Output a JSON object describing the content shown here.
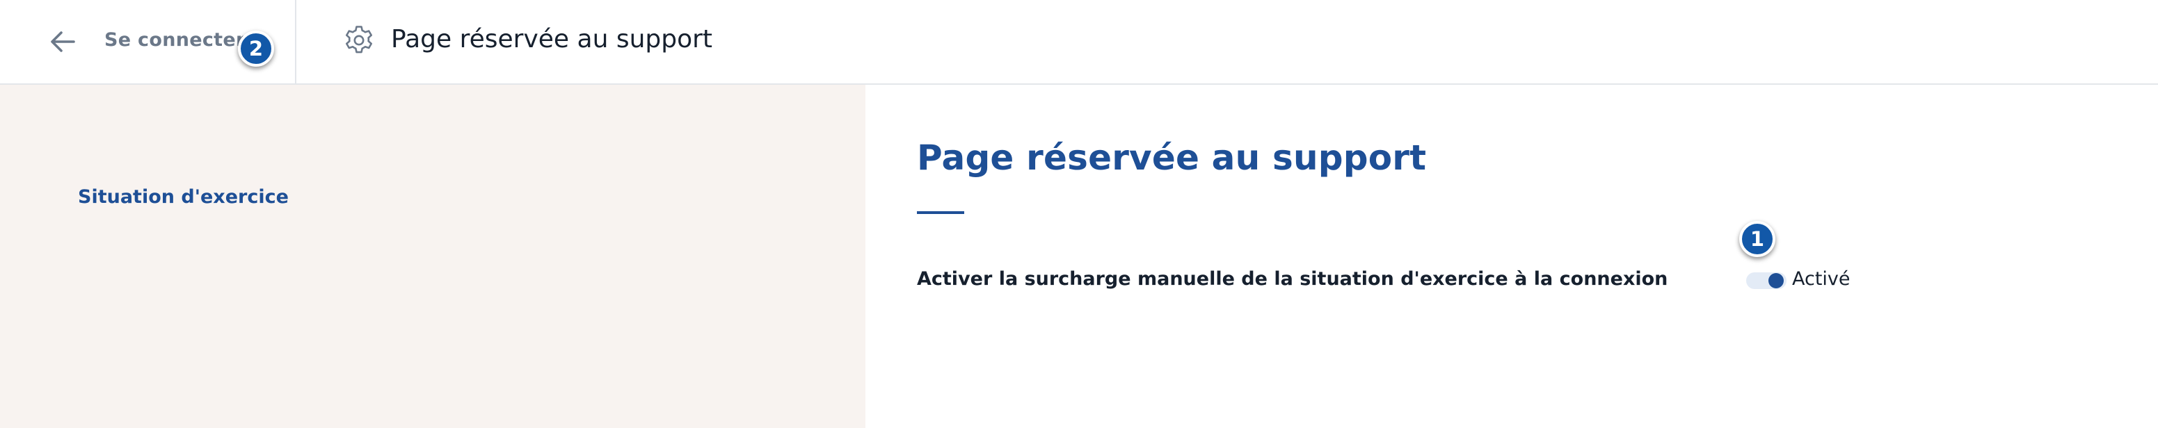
{
  "header": {
    "back_label": "Se connecter",
    "title": "Page réservée au support",
    "back_icon": "arrow-left-icon",
    "title_icon": "gear-icon"
  },
  "annotations": {
    "marker_1": "1",
    "marker_2": "2"
  },
  "sidebar": {
    "items": [
      {
        "label": "Situation d'exercice"
      }
    ]
  },
  "main": {
    "title": "Page réservée au support",
    "settings": [
      {
        "label": "Activer la surcharge manuelle de la situation d'exercice à la connexion",
        "toggle_on": true,
        "status": "Activé"
      }
    ]
  },
  "colors": {
    "accent": "#1e4f96",
    "sidebar_bg": "#f8f3f0",
    "marker_bg": "#1258a8",
    "muted_text": "#6b7889"
  }
}
